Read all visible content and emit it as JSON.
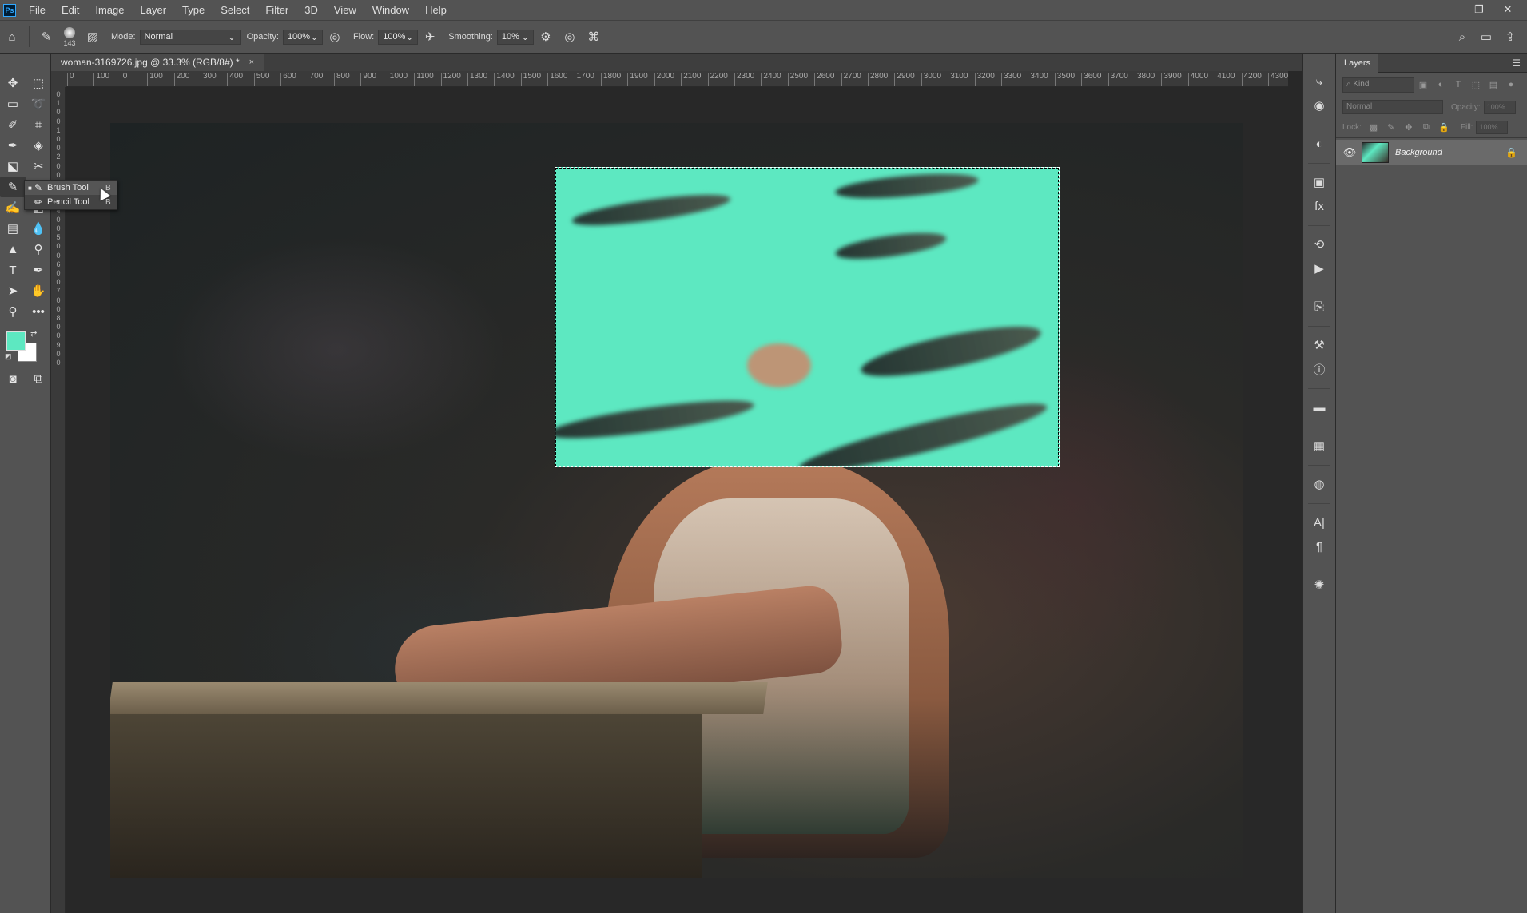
{
  "app": {
    "logo": "Ps",
    "menu": [
      "File",
      "Edit",
      "Image",
      "Layer",
      "Type",
      "Select",
      "Filter",
      "3D",
      "View",
      "Window",
      "Help"
    ]
  },
  "window_controls": {
    "minimize": "–",
    "restore": "❐",
    "close": "✕"
  },
  "options": {
    "brush_size": "143",
    "mode_label": "Mode:",
    "mode_value": "Normal",
    "opacity_label": "Opacity:",
    "opacity_value": "100%",
    "flow_label": "Flow:",
    "flow_value": "100%",
    "smoothing_label": "Smoothing:",
    "smoothing_value": "10%"
  },
  "document": {
    "tab_title": "woman-3169726.jpg @ 33.3% (RGB/8#) *",
    "close": "×"
  },
  "ruler_h": [
    "0",
    "100",
    "0",
    "100",
    "200",
    "300",
    "400",
    "500",
    "600",
    "700",
    "800",
    "900",
    "1000",
    "1100",
    "1200",
    "1300",
    "1400",
    "1500",
    "1600",
    "1700",
    "1800",
    "1900",
    "2000",
    "2100",
    "2200",
    "2300",
    "2400",
    "2500",
    "2600",
    "2700",
    "2800",
    "2900",
    "3000",
    "3100",
    "3200",
    "3300",
    "3400",
    "3500",
    "3600",
    "3700",
    "3800",
    "3900",
    "4000",
    "4100",
    "4200",
    "4300",
    "4"
  ],
  "ruler_v": [
    "0",
    "1",
    "0",
    "0",
    "1",
    "0",
    "0",
    "2",
    "0",
    "0",
    "3",
    "0",
    "0",
    "4",
    "0",
    "0",
    "5",
    "0",
    "0",
    "6",
    "0",
    "0",
    "7",
    "0",
    "0",
    "8",
    "0",
    "0",
    "9",
    "0",
    "0"
  ],
  "flyout": {
    "items": [
      {
        "label": "Brush Tool",
        "key": "B",
        "selected": true
      },
      {
        "label": "Pencil Tool",
        "key": "B",
        "selected": false
      }
    ]
  },
  "colors": {
    "foreground": "#5de8c1",
    "background": "#ffffff",
    "accent": "#31a8ff"
  },
  "layers_panel": {
    "tab": "Layers",
    "kind_placeholder": "Kind",
    "blend_mode": "Normal",
    "opacity_label": "Opacity:",
    "opacity_value": "100%",
    "lock_label": "Lock:",
    "fill_label": "Fill:",
    "fill_value": "100%",
    "layers": [
      {
        "name": "Background",
        "locked": true,
        "visible": true
      }
    ]
  }
}
